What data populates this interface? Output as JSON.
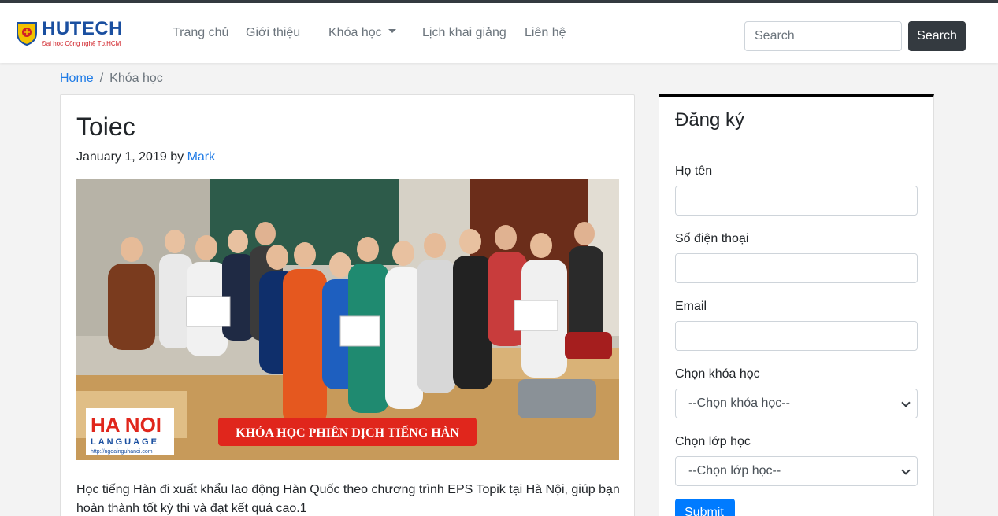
{
  "navbar": {
    "logo_text": "HUTECH",
    "logo_tagline": "Đại học Công nghệ Tp.HCM",
    "items": [
      {
        "label": "Trang chủ"
      },
      {
        "label": "Giới thiệu"
      },
      {
        "label": "Khóa học",
        "dropdown": true
      },
      {
        "label": "Lịch khai giảng"
      },
      {
        "label": "Liên hệ"
      }
    ],
    "search_placeholder": "Search",
    "search_button": "Search"
  },
  "breadcrumb": {
    "home": "Home",
    "separator": "/",
    "current": "Khóa học"
  },
  "post": {
    "title": "Toiec",
    "date": "January 1, 2019",
    "by": "by",
    "author": "Mark",
    "image_banner": "KHÓA HỌC PHIÊN DỊCH TIẾNG HÀN",
    "image_logo_top": "HA NOI",
    "image_logo_bottom": "LANGUAGE",
    "image_url_text": "http://ngoainguhanoi.com",
    "excerpt": "Học tiếng Hàn đi xuất khẩu lao động Hàn Quốc theo chương trình EPS Topik tại Hà Nội, giúp bạn hoàn thành tốt kỳ thi và đạt kết quả cao.1"
  },
  "signup": {
    "title": "Đăng ký",
    "name_label": "Họ tên",
    "phone_label": "Số điện thoại",
    "email_label": "Email",
    "course_label": "Chọn khóa học",
    "course_selected": "--Chọn khóa học--",
    "class_label": "Chọn lớp học",
    "class_selected": "--Chọn lớp học--",
    "submit": "Submit"
  },
  "colors": {
    "link": "#1f7be6",
    "dark_button": "#343a40",
    "primary": "#007bff",
    "banner_red": "#e0261c"
  }
}
